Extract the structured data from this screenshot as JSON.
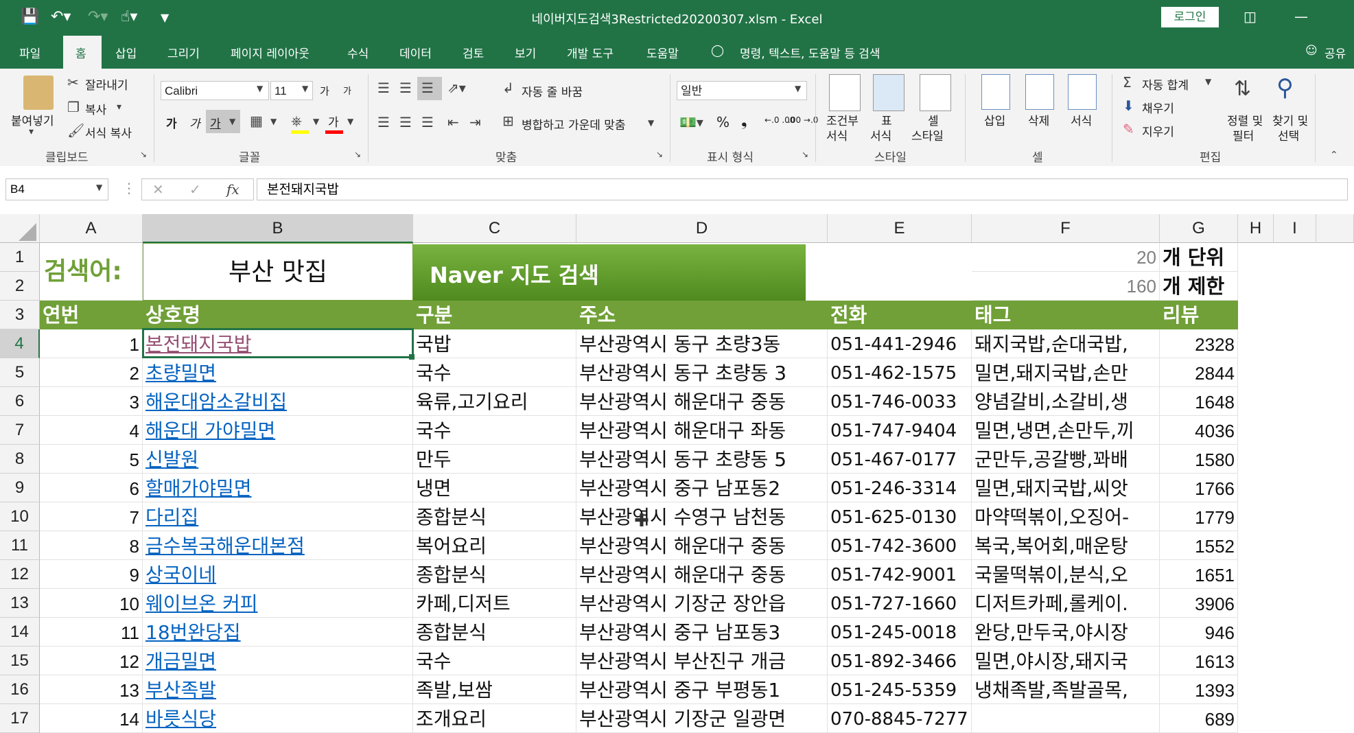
{
  "window": {
    "title": "네이버지도검색3Restricted20200307.xlsm  -  Excel",
    "login_label": "로그인",
    "share_label": "공유"
  },
  "tabs": [
    "파일",
    "홈",
    "삽입",
    "그리기",
    "페이지 레이아웃",
    "수식",
    "데이터",
    "검토",
    "보기",
    "개발 도구",
    "도움말"
  ],
  "tell_me": "명령, 텍스트, 도움말 등 검색",
  "ribbon": {
    "clipboard": {
      "paste": "붙여넣기",
      "cut": "잘라내기",
      "copy": "복사",
      "format_painter": "서식 복사",
      "title": "클립보드"
    },
    "font": {
      "name": "Calibri",
      "size": "11",
      "bold": "가",
      "italic": "가",
      "underline": "가",
      "grow": "가",
      "shrink": "가",
      "title": "글꼴"
    },
    "alignment": {
      "wrap": "자동 줄 바꿈",
      "merge": "병합하고 가운데 맞춤",
      "title": "맞춤"
    },
    "number": {
      "format": "일반",
      "percent": "%",
      "comma": "❟",
      "inc_decimal": "←.0 .00",
      "dec_decimal": ".00 →.0",
      "title": "표시 형식"
    },
    "styles": {
      "conditional": "조건부",
      "conditional2": "서식",
      "table": "표",
      "table2": "서식",
      "cell": "셀",
      "cell2": "스타일",
      "title": "스타일"
    },
    "cells": {
      "insert": "삽입",
      "delete": "삭제",
      "format": "서식",
      "title": "셀"
    },
    "editing": {
      "autosum": "자동 합계",
      "fill": "채우기",
      "clear": "지우기",
      "sort": "정렬 및",
      "sort2": "필터",
      "find": "찾기 및",
      "find2": "선택",
      "title": "편집"
    }
  },
  "formula_bar": {
    "name_box": "B4",
    "value": "본전돼지국밥"
  },
  "columns": [
    "A",
    "B",
    "C",
    "D",
    "E",
    "F",
    "G",
    "H",
    "I"
  ],
  "rows": [
    "1",
    "2",
    "3",
    "4",
    "5",
    "6",
    "7",
    "8",
    "9",
    "10",
    "11",
    "12",
    "13",
    "14",
    "15",
    "16",
    "17"
  ],
  "sheet": {
    "search_label": "검색어:",
    "search_term": "부산 맛집",
    "search_button": "Naver 지도 검색",
    "unit_value": "20",
    "unit_label": "개 단위",
    "limit_value": "160",
    "limit_label": "개 제한",
    "headers": [
      "연번",
      "상호명",
      "구분",
      "주소",
      "전화",
      "태그",
      "리뷰"
    ],
    "data": [
      [
        "1",
        "본전돼지국밥",
        "국밥",
        "부산광역시 동구 초량3동",
        "051-441-2946",
        "돼지국밥,순대국밥,",
        "2328"
      ],
      [
        "2",
        "초량밀면",
        "국수",
        "부산광역시 동구 초량동 3",
        "051-462-1575",
        "밀면,돼지국밥,손만",
        "2844"
      ],
      [
        "3",
        "해운대암소갈비집",
        "육류,고기요리",
        "부산광역시 해운대구 중동",
        "051-746-0033",
        "양념갈비,소갈비,생",
        "1648"
      ],
      [
        "4",
        "해운대 가야밀면",
        "국수",
        "부산광역시 해운대구 좌동",
        "051-747-9404",
        "밀면,냉면,손만두,끼",
        "4036"
      ],
      [
        "5",
        "신발원",
        "만두",
        "부산광역시 동구 초량동 5",
        "051-467-0177",
        "군만두,공갈빵,꽈배",
        "1580"
      ],
      [
        "6",
        "할매가야밀면",
        "냉면",
        "부산광역시 중구 남포동2",
        "051-246-3314",
        "밀면,돼지국밥,씨앗",
        "1766"
      ],
      [
        "7",
        "다리집",
        "종합분식",
        "부산광역시 수영구 남천동",
        "051-625-0130",
        "마약떡볶이,오징어-",
        "1779"
      ],
      [
        "8",
        "금수복국해운대본점",
        "복어요리",
        "부산광역시 해운대구 중동",
        "051-742-3600",
        "복국,복어회,매운탕",
        "1552"
      ],
      [
        "9",
        "상국이네",
        "종합분식",
        "부산광역시 해운대구 중동",
        "051-742-9001",
        "국물떡볶이,분식,오",
        "1651"
      ],
      [
        "10",
        "웨이브온 커피",
        "카페,디저트",
        "부산광역시 기장군 장안읍",
        "051-727-1660",
        "디저트카페,롤케이.",
        "3906"
      ],
      [
        "11",
        "18번완당집",
        "종합분식",
        "부산광역시 중구 남포동3",
        "051-245-0018",
        "완당,만두국,야시장",
        "946"
      ],
      [
        "12",
        "개금밀면",
        "국수",
        "부산광역시 부산진구 개금",
        "051-892-3466",
        "밀면,야시장,돼지국",
        "1613"
      ],
      [
        "13",
        "부산족발",
        "족발,보쌈",
        "부산광역시 중구 부평동1",
        "051-245-5359",
        "냉채족발,족발골목,",
        "1393"
      ],
      [
        "14",
        "바릇식당",
        "조개요리",
        "부산광역시 기장군 일광면",
        "070-8845-7277",
        "",
        "689"
      ]
    ]
  }
}
